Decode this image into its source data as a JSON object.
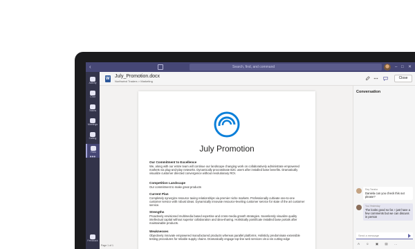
{
  "app": {
    "search_placeholder": "Search, find, and command",
    "window_controls": [
      "–",
      "□",
      "✕"
    ]
  },
  "rail": {
    "items": [
      {
        "label": "Activity",
        "active": false
      },
      {
        "label": "Chat",
        "active": false
      },
      {
        "label": "Teams",
        "active": false
      },
      {
        "label": "Meetings",
        "active": false
      },
      {
        "label": "Calling",
        "active": false
      },
      {
        "label": "Files",
        "active": true
      }
    ],
    "more": "•••",
    "help_label": "Feedback"
  },
  "doc_header": {
    "title": "July_Promotion.docx",
    "subtitle": "Northwind Traders > Marketing",
    "close_label": "Close"
  },
  "document": {
    "heading": "July Promotion",
    "sections": [
      {
        "title": "Our Commitment to Excellence",
        "text": "We, along with our entire team will continue our landscape changing work on collaboratively administrate empowered markets via plug-and-play networks. Dynamically procrastinate B2C users after installed base benefits. Dramatically visualize customer directed convergence without revolutionary ROI."
      },
      {
        "title": "Competition Landscape",
        "text": "Our commitment to make great products"
      },
      {
        "title": "Current Plan",
        "text": "Completely synergize resource taxing relationships via premier niche markets. Professionally cultivate one-to-one customer service with robust ideas. Dynamically innovate resource-leveling customer service for state of the art customer service."
      },
      {
        "title": "Strengths",
        "text": "Proactively envisioned multimedia based expertise and cross-media growth strategies. Seamlessly visualize quality intellectual capital without superior collaboration and idea-sharing. Holistically pontificate installed base portals after maintainable products."
      },
      {
        "title": "Weaknesses",
        "text": "Objectively innovate empowered manufactured products whereas parallel platforms. Holisticly predominate extensible testing procedures for reliable supply chains. Dramatically engage top-line web services vis-a-vis cutting-edge"
      }
    ],
    "status": "Page 1 of 1"
  },
  "conversation": {
    "title": "Conversation",
    "messages": [
      {
        "author": "Ray Tanaka",
        "time": "",
        "text": "Daniela can you check this out please?",
        "mine": false
      },
      {
        "author": "You",
        "time": "Yesterday",
        "text": "The looks good so far. I just have a few comments but we can discuss in person",
        "mine": true
      }
    ],
    "reply_placeholder": "Send a message",
    "tools": "A ☺ ▣ ▤ …"
  },
  "colors": {
    "brand": "#464775",
    "rail": "#33344a",
    "accent": "#6264a7",
    "logo": "#0a7fd9"
  }
}
